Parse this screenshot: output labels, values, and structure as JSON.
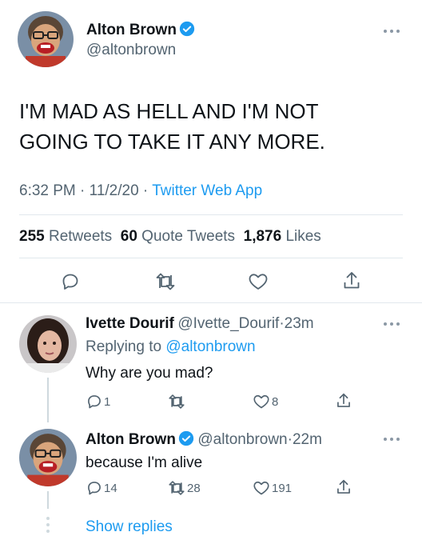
{
  "main_tweet": {
    "author_name": "Alton Brown",
    "author_handle": "@altonbrown",
    "text_line1": "I'M MAD AS HELL AND I'M NOT",
    "text_line2": "GOING TO TAKE IT ANY MORE.",
    "time": "6:32 PM",
    "date": "11/2/20",
    "source": "Twitter Web App",
    "separator": "·",
    "retweets_count": "255",
    "retweets_label": "Retweets",
    "quotes_count": "60",
    "quotes_label": "Quote Tweets",
    "likes_count": "1,876",
    "likes_label": "Likes"
  },
  "replies": [
    {
      "author_name": "Ivette Dourif",
      "author_handle": "@Ivette_Dourif",
      "time_ago": "23m",
      "replying_to_label": "Replying to",
      "replying_to_handle": "@altonbrown",
      "text": "Why are you mad?",
      "reply_count": "1",
      "retweet_count": "",
      "like_count": "8"
    },
    {
      "author_name": "Alton Brown",
      "author_handle": "@altonbrown",
      "time_ago": "22m",
      "text": "because I'm alive",
      "reply_count": "14",
      "retweet_count": "28",
      "like_count": "191"
    }
  ],
  "show_replies_label": "Show replies",
  "icons": {
    "verified": "verified-badge-icon",
    "more": "more-options-icon",
    "reply": "reply-icon",
    "retweet": "retweet-icon",
    "like": "heart-icon",
    "share": "share-icon"
  },
  "colors": {
    "accent": "#1d9bf0",
    "secondary_text": "#536471",
    "primary_text": "#0f1419"
  }
}
